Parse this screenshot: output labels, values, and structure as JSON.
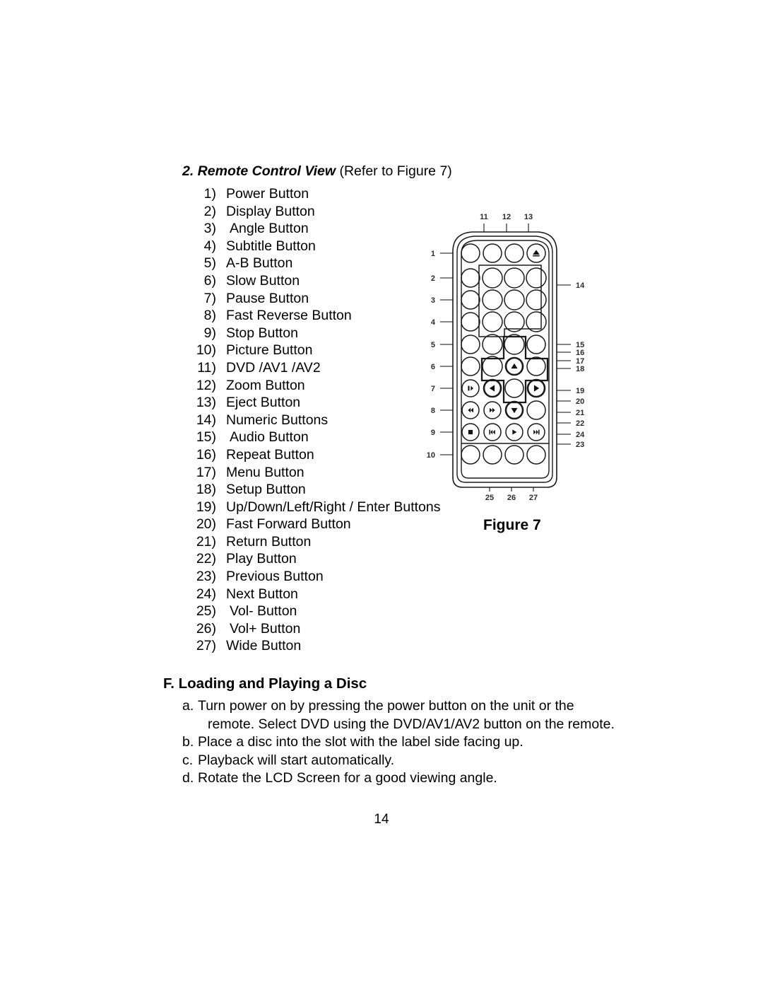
{
  "document": {
    "page_number": "14"
  },
  "section": {
    "heading_strong": "2. Remote Control View",
    "heading_plain": " (Refer to Figure 7)"
  },
  "button_list": [
    {
      "num": "1)",
      "label": "Power Button",
      "extra_space": false
    },
    {
      "num": "2)",
      "label": "Display Button",
      "extra_space": false
    },
    {
      "num": "3)",
      "label": "Angle Button",
      "extra_space": true
    },
    {
      "num": "4)",
      "label": "Subtitle Button",
      "extra_space": false
    },
    {
      "num": "5)",
      "label": "A-B Button",
      "extra_space": false
    },
    {
      "num": "6)",
      "label": "Slow Button",
      "extra_space": false
    },
    {
      "num": "7)",
      "label": "Pause Button",
      "extra_space": false
    },
    {
      "num": "8)",
      "label": "Fast Reverse Button",
      "extra_space": false
    },
    {
      "num": "9)",
      "label": "Stop Button",
      "extra_space": false
    },
    {
      "num": "10)",
      "label": "Picture Button",
      "extra_space": false
    },
    {
      "num": "11)",
      "label": "DVD /AV1 /AV2",
      "extra_space": false
    },
    {
      "num": "12)",
      "label": "Zoom Button",
      "extra_space": false
    },
    {
      "num": "13)",
      "label": "Eject Button",
      "extra_space": false
    },
    {
      "num": "14)",
      "label": "Numeric Buttons",
      "extra_space": false
    },
    {
      "num": "15)",
      "label": "Audio Button",
      "extra_space": true
    },
    {
      "num": "16)",
      "label": "Repeat Button",
      "extra_space": false
    },
    {
      "num": "17)",
      "label": "Menu Button",
      "extra_space": false
    },
    {
      "num": "18)",
      "label": "Setup Button",
      "extra_space": false
    },
    {
      "num": "19)",
      "label": "Up/Down/Left/Right / Enter Buttons",
      "extra_space": false
    },
    {
      "num": "20)",
      "label": "Fast Forward Button",
      "extra_space": false
    },
    {
      "num": "21)",
      "label": "Return Button",
      "extra_space": false
    },
    {
      "num": "22)",
      "label": "Play Button",
      "extra_space": false
    },
    {
      "num": "23)",
      "label": "Previous Button",
      "extra_space": false
    },
    {
      "num": "24)",
      "label": "Next Button",
      "extra_space": false
    },
    {
      "num": "25)",
      "label": "Vol- Button",
      "extra_space": true
    },
    {
      "num": "26)",
      "label": "Vol+ Button",
      "extra_space": true
    },
    {
      "num": "27)",
      "label": "Wide Button",
      "extra_space": false
    }
  ],
  "loading_section": {
    "heading": "F. Loading and Playing a Disc",
    "steps": [
      {
        "letter": "a.",
        "line1": "Turn power on by pressing the power button on the unit or the",
        "line2": "remote. Select DVD using the DVD/AV1/AV2 button on the remote."
      },
      {
        "letter": "b.",
        "line1": "Place a disc into the slot with the label side facing up.",
        "line2": ""
      },
      {
        "letter": "c.",
        "line1": "Playback will start automatically.",
        "line2": ""
      },
      {
        "letter": "d.",
        "line1": "Rotate the LCD Screen for a good viewing angle.",
        "line2": ""
      }
    ]
  },
  "figure": {
    "caption": "Figure 7",
    "callouts_top": [
      "11",
      "12",
      "13"
    ],
    "callouts_left": [
      "1",
      "2",
      "3",
      "4",
      "5",
      "6",
      "7",
      "8",
      "9",
      "10"
    ],
    "callouts_right": [
      "14",
      "15",
      "16",
      "17",
      "18",
      "19",
      "20",
      "21",
      "22",
      "24",
      "23"
    ],
    "callouts_bottom": [
      "25",
      "26",
      "27"
    ],
    "button_icons": {
      "eject": "eject-triangle-icon",
      "pause": "pause-icon",
      "fast_reverse": "fast-reverse-icon",
      "stop": "stop-icon",
      "fast_forward": "fast-forward-icon",
      "previous": "previous-track-icon",
      "play": "play-icon",
      "next": "next-track-icon",
      "up": "arrow-up-icon",
      "down": "arrow-down-icon",
      "left": "arrow-left-icon",
      "right": "arrow-right-icon",
      "enter": "enter-center-icon"
    },
    "colors": {
      "outline": "#1a1a1a",
      "leader": "#3a3a3a",
      "glyph_fill": "#111111"
    }
  }
}
